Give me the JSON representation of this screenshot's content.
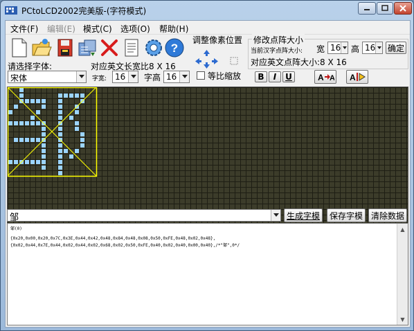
{
  "window": {
    "title": "PCtoLCD2002完美版-(字符模式)"
  },
  "menu": [
    {
      "label": "文件(F)",
      "enabled": true
    },
    {
      "label": "编辑(E)",
      "enabled": false
    },
    {
      "label": "模式(C)",
      "enabled": true
    },
    {
      "label": "选项(O)",
      "enabled": true
    },
    {
      "label": "帮助(H)",
      "enabled": true
    }
  ],
  "toolbar": {
    "icons": [
      "new-file-icon",
      "open-folder-icon",
      "save-disk-icon",
      "import-icon",
      "delete-icon",
      "notes-icon",
      "settings-gear-icon",
      "help-icon"
    ]
  },
  "font_panel": {
    "select_font_label": "请选择字体:",
    "font_value": "宋体",
    "width_label": "字宽:",
    "width_value": "16",
    "height_label": "字高",
    "height_value": "16",
    "scale_label": "等比缩放",
    "scale_checked": false,
    "corresponding_en_label": "对应英文长宽比8 X 16",
    "bold_label": "B",
    "italic_label": "I",
    "underline_label": "U"
  },
  "adjust_pixels": {
    "title": "调整像素位置"
  },
  "matrix_size": {
    "title": "修改点阵大小",
    "current_label": "当前汉字点阵大小:",
    "width_label": "宽",
    "width_value": "16",
    "height_label": "高",
    "height_value": "16",
    "confirm_label": "确定",
    "en_size_label": "对应英文点阵大小:8 X 16"
  },
  "input": {
    "character": "邹"
  },
  "buttons": {
    "generate": "生成字模",
    "save": "保存字模",
    "clear": "清除数据"
  },
  "output": {
    "lines": [
      "邹(0)",
      "",
      "{0x20,0x00,0x20,0x7C,0x3E,0x44,0x42,0x48,0x84,0x48,0x08,0x50,0xFE,0x48,0x02,0x48},",
      "{0x02,0x44,0x7E,0x44,0x02,0x44,0x02,0x68,0x02,0x50,0xFE,0x40,0x02,0x40,0x00,0x40},/*\"邹\",0*/"
    ]
  },
  "colors": {
    "grid_bg": "#3c3c2a",
    "grid_line": "#1e1e14",
    "pixel_on": "#9cd4ff",
    "selection": "#ffff00"
  },
  "glyph_rows": [
    "0010000000000000",
    "0010000001111100",
    "0011111001000100",
    "0100001001001000",
    "1000010001001000",
    "0000100001010000",
    "1111111001001000",
    "0000001001001000",
    "0000001001000100",
    "0111111001000100",
    "0000001001000100",
    "0000001001101000",
    "0000001001010000",
    "1111111001000000",
    "0000001001000000",
    "0000000001000000"
  ]
}
